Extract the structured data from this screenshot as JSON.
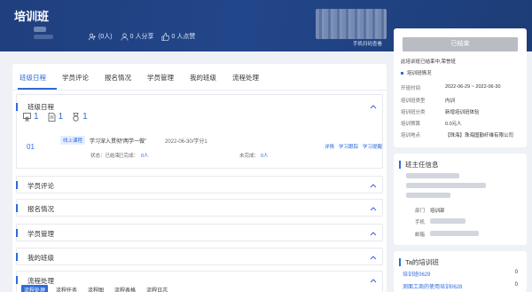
{
  "banner": {
    "title": "培训班",
    "stats": [
      {
        "icon": "users-share-icon",
        "text": "(0人)"
      },
      {
        "icon": "person-icon",
        "text": "0"
      },
      {
        "icon": "share-text",
        "text": "人分享"
      },
      {
        "icon": "thumbs-up-icon",
        "text": "0"
      },
      {
        "icon": "like-text",
        "text": "人点赞"
      }
    ],
    "qr_caption": "手机扫码查看"
  },
  "tabs": [
    "班级日程",
    "学员评论",
    "报名情况",
    "学员管理",
    "我的班级",
    "流程处理"
  ],
  "active_tab": "班级日程",
  "schedule": {
    "title": "班级日程",
    "counts": [
      {
        "icon": "certificate-icon",
        "value": "1"
      },
      {
        "icon": "document-icon",
        "value": "1"
      },
      {
        "icon": "medal-icon",
        "value": "1"
      }
    ],
    "course": {
      "num": "01",
      "tag": "线上课程",
      "title": "学习深入贯彻“两学一做”",
      "date": "2022-06-30/学分1",
      "status": "状态：已结束",
      "done_label": "已完成：",
      "done_value": "0人",
      "undone_label": "未完成：",
      "undone_value": "0人",
      "links": [
        "详情",
        "学习跟踪",
        "学习提醒"
      ]
    }
  },
  "sections": [
    {
      "key": "comments",
      "title": "学员评论"
    },
    {
      "key": "signup",
      "title": "报名情况"
    },
    {
      "key": "manage",
      "title": "学员管理"
    },
    {
      "key": "myclass",
      "title": "我的班级"
    }
  ],
  "flow": {
    "title": "流程处理",
    "tabs": [
      "流程处理",
      "流程任务",
      "流程图",
      "流程表格",
      "流程日志"
    ]
  },
  "side": {
    "ended_button": "已结束",
    "ended_note": "此培训班已结束中,荣誉班",
    "info_title": "培训班情况",
    "info": [
      {
        "k": "开班时间",
        "v": "2022-06-29 ~ 2022-06-30"
      },
      {
        "k": "培训班类型",
        "v": "内训"
      },
      {
        "k": "培训班分类",
        "v": "新增培训班体验"
      },
      {
        "k": "培训预算",
        "v": "0.0元人"
      },
      {
        "k": "培训地点",
        "v": "【珠海】珠海国勤纤维有限公司"
      }
    ],
    "teacher_title": "班主任信息",
    "teacher": [
      {
        "k": "部门",
        "v": "培训部"
      },
      {
        "k": "手机",
        "v": ""
      },
      {
        "k": "邮箱",
        "v": ""
      }
    ],
    "ta_title": "Ta的培训班",
    "classes": [
      {
        "name": "培训班0629",
        "count": "0"
      },
      {
        "name": "测面工商的使用培训0628",
        "count": "0"
      }
    ]
  },
  "colors": {
    "accent": "#2e6bd8",
    "banner": "#22468a",
    "ended": "#b9bcc2"
  }
}
